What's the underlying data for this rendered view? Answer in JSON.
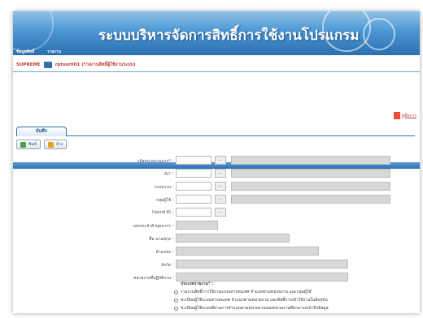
{
  "app": {
    "title": "ระบบบริหารจัดการสิทธิ์การใช้งานโปรแกรม",
    "nav": [
      "ข้อมูลสิทธิ์",
      "รายงาน"
    ]
  },
  "breadcrumb": {
    "system": "SUPREME",
    "page": "rptusr001 (รายงานสิทธิ์ผู้ใช้งานระบบ)"
  },
  "report_link": "คู่มือการ",
  "tab": {
    "label": "บันทึก"
  },
  "toolbar": {
    "print_label": "พิมพ์",
    "clear_label": "ล้าง"
  },
  "form": {
    "fields": [
      {
        "label": "รหัสหน่วยงานจาก",
        "required": true,
        "dots": "..."
      },
      {
        "label": "ถึง",
        "required": true,
        "dots": "..."
      },
      {
        "label": "ระบบงาน",
        "required": false,
        "dots": "..."
      },
      {
        "label": "กลุ่มผู้ใช้",
        "required": false,
        "dots": "..."
      },
      {
        "label": "Userid ID",
        "required": false,
        "dots": "..."
      },
      {
        "label": "เลขประจำตัวบุคลากร",
        "required": false
      },
      {
        "label": "ชื่อ-นามสกุล",
        "required": false
      },
      {
        "label": "ตำแหน่ง",
        "required": false
      },
      {
        "label": "สังกัด",
        "required": false
      },
      {
        "label": "หน่วยงานที่ปฏิบัติงาน",
        "required": false
      }
    ],
    "report_type": {
      "label": "ประเภทรายงาน",
      "options": [
        "รายงานสิทธิ์การใช้งานระบบสารสนเทศ จำแนกตามหน่วยงาน และกลุ่มผู้ใช้",
        "ทะเบียนผู้ใช้ระบบสารสนเทศ จำแนกตามหน่วยงาน และสิทธิ์การเข้าใช้งานในปัจจุบัน",
        "ทะเบียนผู้ใช้ระบบที่ผ่านการจำแนกตามหน่วยงานของหน่วยงานที่สามารถเข้าถึงข้อมูล"
      ]
    }
  }
}
